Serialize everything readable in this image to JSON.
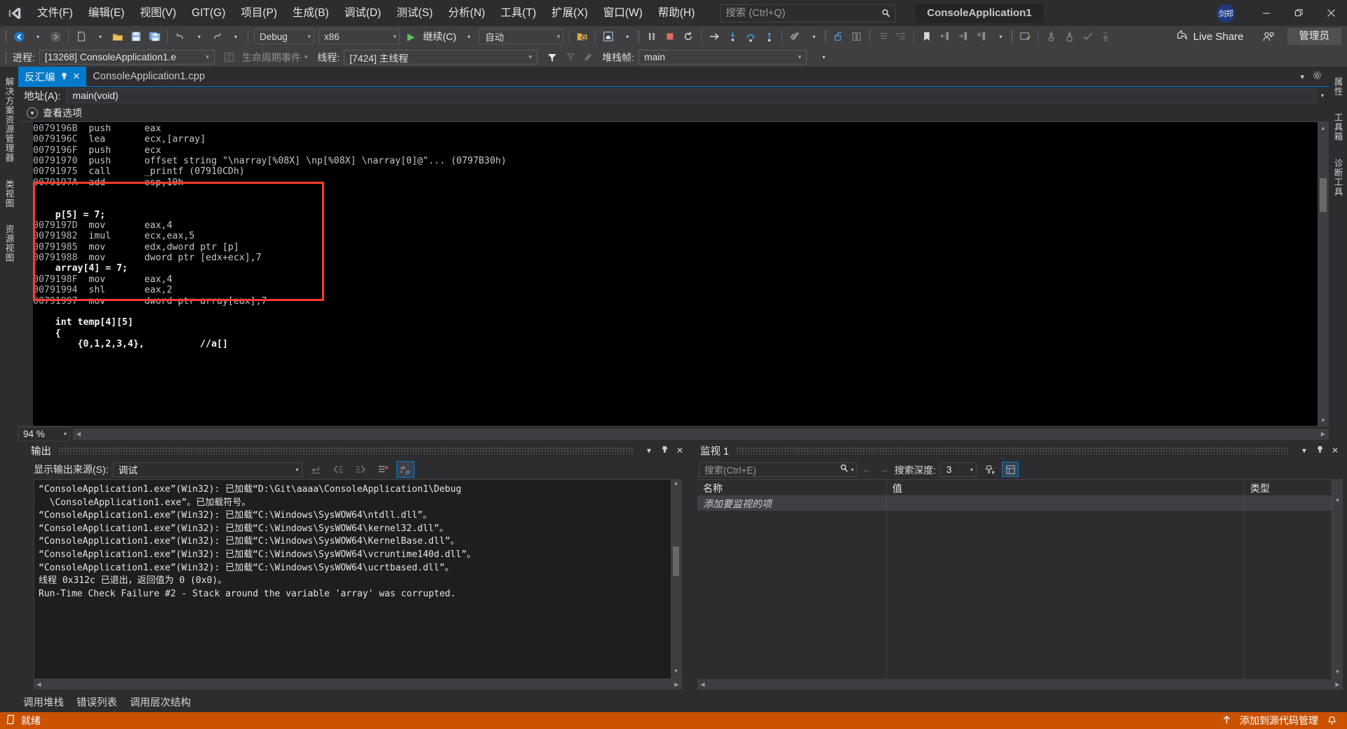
{
  "titlebar": {
    "logo_icon": "visual-studio-logo-icon",
    "menus": [
      {
        "label": "文件(F)",
        "key": "F"
      },
      {
        "label": "编辑(E)",
        "key": "E"
      },
      {
        "label": "视图(V)",
        "key": "V"
      },
      {
        "label": "GIT(G)",
        "key": "G"
      },
      {
        "label": "项目(P)",
        "key": "P"
      },
      {
        "label": "生成(B)",
        "key": "B"
      },
      {
        "label": "调试(D)",
        "key": "D"
      },
      {
        "label": "测试(S)",
        "key": "S"
      },
      {
        "label": "分析(N)",
        "key": "N"
      },
      {
        "label": "工具(T)",
        "key": "T"
      },
      {
        "label": "扩展(X)",
        "key": "X"
      },
      {
        "label": "窗口(W)",
        "key": "W"
      },
      {
        "label": "帮助(H)",
        "key": "H"
      }
    ],
    "search_placeholder": "搜索 (Ctrl+Q)",
    "search_value": "",
    "solution_name": "ConsoleApplication1",
    "avatar_text": "剑郑",
    "minimize_label": "—",
    "maximize_label": "❐",
    "close_label": "✕"
  },
  "toolbar": {
    "config_value": "Debug",
    "platform_value": "x86",
    "continue_label": "继续(C)",
    "auto_value": "自动",
    "live_share_label": "Live Share",
    "admin_label": "管理员",
    "icons": [
      "navigate-back-icon",
      "navigate-forward-icon",
      "new-file-icon",
      "open-file-icon",
      "save-icon",
      "save-all-icon",
      "undo-icon",
      "redo-icon",
      "start-debug-icon",
      "find-in-files-icon",
      "home-icon",
      "pause-icon",
      "stop-icon",
      "restart-icon",
      "show-next-statement-icon",
      "step-into-icon",
      "step-over-icon",
      "step-out-icon",
      "diagnostics-icon",
      "hot-reload-icon",
      "compare-icon",
      "indent-icon",
      "comment-icon",
      "bookmark-icon",
      "prev-bookmark-icon",
      "next-bookmark-icon",
      "clear-bookmark-icon",
      "bookmark-settings-icon",
      "breakpoint-down-icon",
      "breakpoint-up-icon",
      "check-icon",
      "quotes-icon",
      "live-share-icon",
      "share-person-icon"
    ]
  },
  "debugbar": {
    "process_label": "进程:",
    "process_value": "[13268] ConsoleApplication1.e",
    "lifecycle_label": "生命周期事件",
    "thread_label": "线程:",
    "thread_value": "[7424] 主线程",
    "stackframe_label": "堆栈帧:",
    "stackframe_value": "main"
  },
  "left_rail": {
    "items": [
      "解决方案资源管理器",
      "类视图",
      "资源视图"
    ]
  },
  "right_rail": {
    "items": [
      "属性",
      "工具箱",
      "诊断工具"
    ]
  },
  "tabs": {
    "active": {
      "label": "反汇编",
      "pin_icon": "pin-icon",
      "close_icon": "close-icon"
    },
    "inactive": {
      "label": "ConsoleApplication1.cpp"
    }
  },
  "address": {
    "label": "地址(A):",
    "value": "main(void)",
    "dropdown_icon": "chevron-down-icon"
  },
  "view_options": {
    "label": "查看选项",
    "chevron_icon": "chevron-down-icon"
  },
  "disassembly": {
    "zoom_level": "94 %",
    "lines": [
      {
        "addr": "0079196B",
        "mn": "push",
        "op": "eax",
        "type": "asm"
      },
      {
        "addr": "0079196C",
        "mn": "lea",
        "op": "ecx,[array]",
        "type": "asm"
      },
      {
        "addr": "0079196F",
        "mn": "push",
        "op": "ecx",
        "type": "asm"
      },
      {
        "addr": "00791970",
        "mn": "push",
        "op": "offset string \"\\narray[%08X] \\np[%08X] \\narray[0]@\"... (0797B30h)",
        "type": "asm"
      },
      {
        "addr": "00791975",
        "mn": "call",
        "op": "_printf (07910CDh)",
        "type": "asm"
      },
      {
        "addr": "0079197A",
        "mn": "add",
        "op": "esp,10h",
        "type": "asm"
      },
      {
        "addr": "",
        "mn": "",
        "op": "",
        "type": "blank"
      },
      {
        "addr": "",
        "mn": "",
        "op": "",
        "type": "blank"
      },
      {
        "addr": "",
        "mn": "",
        "op": "    p[5] = 7;",
        "type": "src"
      },
      {
        "addr": "0079197D",
        "mn": "mov",
        "op": "eax,4",
        "type": "asm"
      },
      {
        "addr": "00791982",
        "mn": "imul",
        "op": "ecx,eax,5",
        "type": "asm"
      },
      {
        "addr": "00791985",
        "mn": "mov",
        "op": "edx,dword ptr [p]",
        "type": "asm"
      },
      {
        "addr": "00791988",
        "mn": "mov",
        "op": "dword ptr [edx+ecx],7",
        "type": "asm"
      },
      {
        "addr": "",
        "mn": "",
        "op": "    array[4] = 7;",
        "type": "src"
      },
      {
        "addr": "0079198F",
        "mn": "mov",
        "op": "eax,4",
        "type": "asm"
      },
      {
        "addr": "00791994",
        "mn": "shl",
        "op": "eax,2",
        "type": "asm"
      },
      {
        "addr": "00791997",
        "mn": "mov",
        "op": "dword ptr array[eax],7",
        "type": "asm"
      },
      {
        "addr": "",
        "mn": "",
        "op": "",
        "type": "blank"
      },
      {
        "addr": "",
        "mn": "",
        "op": "    int temp[4][5]",
        "type": "src"
      },
      {
        "addr": "",
        "mn": "",
        "op": "    {",
        "type": "src"
      },
      {
        "addr": "",
        "mn": "",
        "op": "        {0,1,2,3,4},          //a[]",
        "type": "src"
      }
    ],
    "highlight_color": "#ff3b30"
  },
  "output_panel": {
    "title": "输出",
    "source_label": "显示输出来源(S):",
    "source_value": "调试",
    "icons": [
      "unwrap-icon",
      "go-to-prev-icon",
      "go-to-next-icon",
      "clear-all-icon",
      "word-wrap-icon"
    ],
    "lines": [
      "“ConsoleApplication1.exe”(Win32): 已加载“D:\\Git\\aaaa\\ConsoleApplication1\\Debug",
      "  \\ConsoleApplication1.exe”。已加载符号。",
      "“ConsoleApplication1.exe”(Win32): 已加载“C:\\Windows\\SysWOW64\\ntdll.dll”。",
      "“ConsoleApplication1.exe”(Win32): 已加载“C:\\Windows\\SysWOW64\\kernel32.dll”。",
      "“ConsoleApplication1.exe”(Win32): 已加载“C:\\Windows\\SysWOW64\\KernelBase.dll”。",
      "“ConsoleApplication1.exe”(Win32): 已加载“C:\\Windows\\SysWOW64\\vcruntime140d.dll”。",
      "“ConsoleApplication1.exe”(Win32): 已加载“C:\\Windows\\SysWOW64\\ucrtbased.dll”。",
      "线程 0x312c 已退出，返回值为 0 (0x0)。",
      "Run-Time Check Failure #2 - Stack around the variable 'array' was corrupted."
    ]
  },
  "watch_panel": {
    "title": "监视 1",
    "search_placeholder": "搜索(Ctrl+E)",
    "depth_label": "搜索深度:",
    "depth_value": "3",
    "columns": [
      "名称",
      "值",
      "类型"
    ],
    "rows": [
      {
        "name": "添加要监视的项",
        "value": "",
        "type": ""
      }
    ],
    "icons": [
      "magnifier-icon",
      "nav-back-icon",
      "nav-forward-icon",
      "pin-column-icon",
      "settings-grid-icon"
    ]
  },
  "bottom_tabs": [
    {
      "label": "调用堆栈"
    },
    {
      "label": "错误列表"
    },
    {
      "label": "调用层次结构"
    }
  ],
  "statusbar": {
    "status_text": "就绪",
    "status_icon": "rect-icon",
    "source_control_label": "添加到源代码管理",
    "source_control_icon": "arrow-up-icon",
    "bell_icon": "bell-icon",
    "background_color": "#ca5100"
  }
}
